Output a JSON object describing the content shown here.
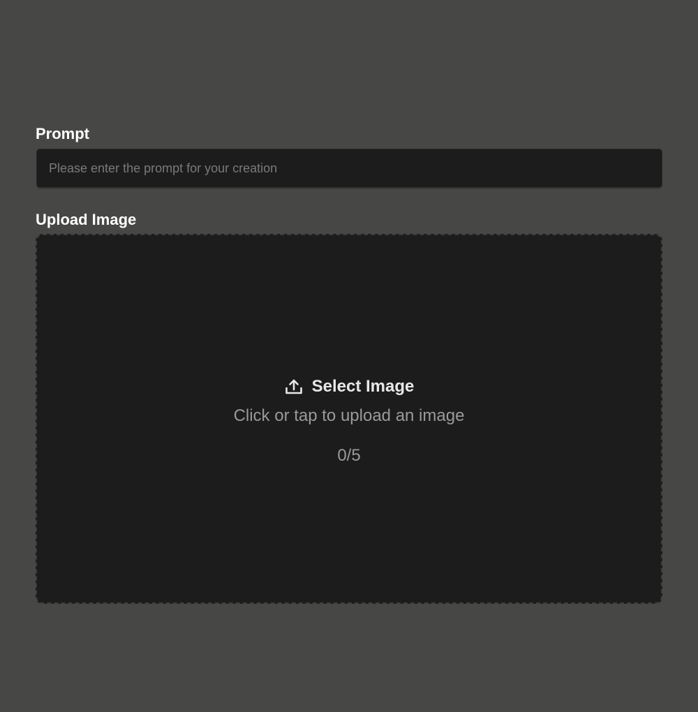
{
  "prompt": {
    "label": "Prompt",
    "placeholder": "Please enter the prompt for your creation",
    "value": ""
  },
  "upload": {
    "label": "Upload Image",
    "title": "Select Image",
    "subtitle": "Click or tap to upload an image",
    "count": "0/5",
    "icon": "upload-icon"
  },
  "colors": {
    "background": "#474746",
    "panel": "#1c1c1c",
    "label": "#ffffff",
    "muted_text": "#9a9a9a"
  }
}
